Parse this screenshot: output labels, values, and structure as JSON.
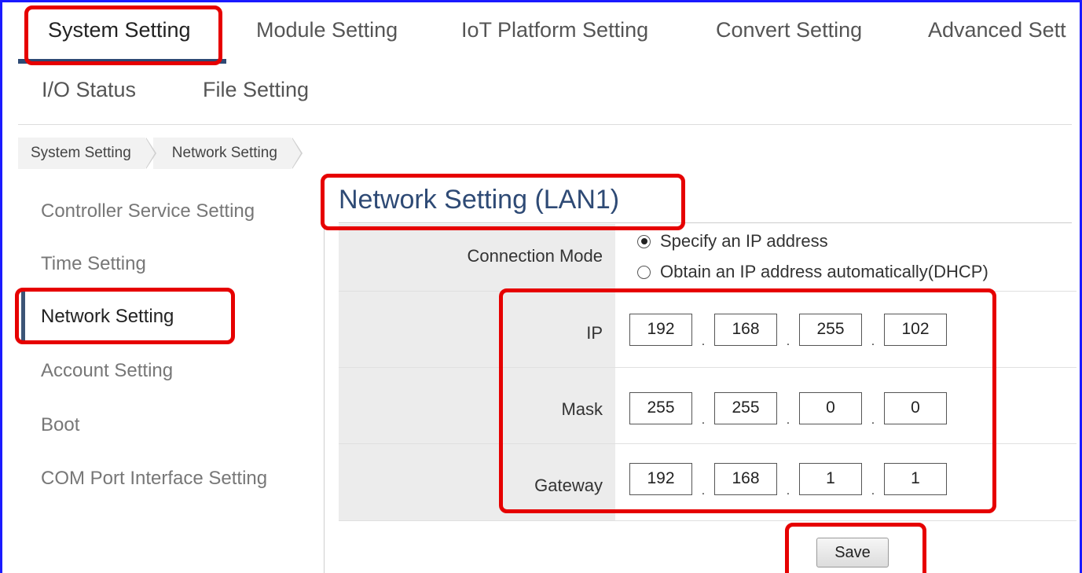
{
  "top_tabs": {
    "row1": [
      "System Setting",
      "Module Setting",
      "IoT Platform Setting",
      "Convert Setting",
      "Advanced Sett"
    ],
    "row2": [
      "I/O Status",
      "File Setting"
    ]
  },
  "breadcrumb": [
    "System Setting",
    "Network Setting"
  ],
  "sidebar": {
    "items": [
      {
        "label": "Controller Service Setting"
      },
      {
        "label": "Time Setting"
      },
      {
        "label": "Network Setting",
        "active": true
      },
      {
        "label": "Account Setting"
      },
      {
        "label": "Boot"
      },
      {
        "label": "COM Port Interface Setting"
      }
    ]
  },
  "main": {
    "title": "Network Setting (LAN1)",
    "connection_mode": {
      "label": "Connection Mode",
      "options": [
        "Specify an IP address",
        "Obtain an IP address automatically(DHCP)"
      ],
      "selected": "Specify an IP address"
    },
    "ip": {
      "label": "IP",
      "octets": [
        "192",
        "168",
        "255",
        "102"
      ]
    },
    "mask": {
      "label": "Mask",
      "octets": [
        "255",
        "255",
        "0",
        "0"
      ]
    },
    "gateway": {
      "label": "Gateway",
      "octets": [
        "192",
        "168",
        "1",
        "1"
      ]
    },
    "ip_separator": ".",
    "save_label": "Save"
  },
  "colors": {
    "accent": "#2e4a75",
    "highlight": "#e60000",
    "frame_border": "#1a1aff"
  }
}
